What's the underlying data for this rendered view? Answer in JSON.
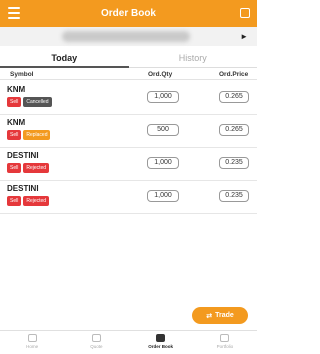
{
  "header": {
    "title": "Order Book",
    "menu_icon": "menu-icon",
    "corner_icon": "expand-icon",
    "color": "#f39a1f"
  },
  "account_bar": {
    "arrow": "►"
  },
  "tabs": [
    {
      "label": "Today",
      "active": true
    },
    {
      "label": "History",
      "active": false
    }
  ],
  "columns": {
    "symbol": "Symbol",
    "qty": "Ord.Qty",
    "price": "Ord.Price"
  },
  "orders": [
    {
      "symbol": "KNM",
      "side": "Sell",
      "status": "Cancelled",
      "status_color": "#555555",
      "qty": "1,000",
      "price": "0.265"
    },
    {
      "symbol": "KNM",
      "side": "Sell",
      "status": "Replaced",
      "status_color": "#f39a1f",
      "qty": "500",
      "price": "0.265"
    },
    {
      "symbol": "DESTINI",
      "side": "Sell",
      "status": "Rejected",
      "status_color": "#e5383b",
      "qty": "1,000",
      "price": "0.235"
    },
    {
      "symbol": "DESTINI",
      "side": "Sell",
      "status": "Rejected",
      "status_color": "#e5383b",
      "qty": "1,000",
      "price": "0.235"
    }
  ],
  "side_color": "#e5383b",
  "trade_button": {
    "label": "Trade",
    "icon": "trade-icon"
  },
  "bottom_nav": [
    {
      "label": "Home",
      "icon": "home-icon",
      "active": false
    },
    {
      "label": "Quote",
      "icon": "quote-icon",
      "active": false
    },
    {
      "label": "Order Book",
      "icon": "order-book-icon",
      "active": true
    },
    {
      "label": "Portfolio",
      "icon": "portfolio-icon",
      "active": false
    }
  ]
}
